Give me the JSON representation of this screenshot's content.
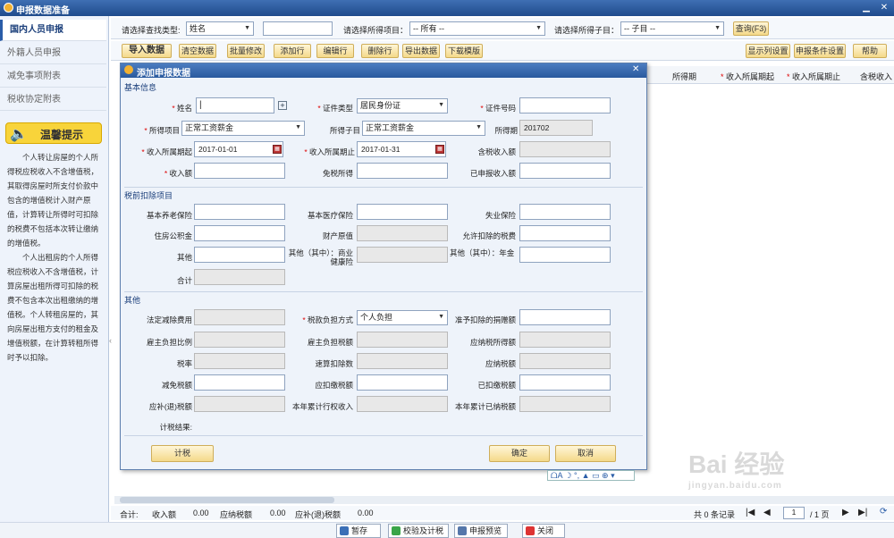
{
  "app": {
    "title": "申报数据准备"
  },
  "sidebar": {
    "items": [
      {
        "label": "国内人员申报"
      },
      {
        "label": "外籍人员申报"
      },
      {
        "label": "减免事项附表"
      },
      {
        "label": "税收协定附表"
      }
    ],
    "tip_title": "温馨提示",
    "tip_p1": "个人转让房屋的个人所得税应税收入不含增值税，其取得房屋时所支付价款中包含的增值税计入财产原值，计算转让所得时可扣除的税费不包括本次转让缴纳的增值税。",
    "tip_p2": "个人出租房的个人所得税应税收入不含增值税，计算房屋出租所得可扣除的税费不包含本次出租缴纳的增值税。个人转租房屋的，其向房屋出租方支付的租金及增值税额，在计算转租所得时予以扣除。"
  },
  "filter": {
    "lookup_label": "请选择查找类型:",
    "lookup_value": "姓名",
    "income_item_label": "请选择所得项目：",
    "income_item_value": "-- 所有 --",
    "income_sub_label": "请选择所得子目：",
    "income_sub_value": "-- 子目 --",
    "query_button": "查询(F3)"
  },
  "toolbar": {
    "import": "导入数据",
    "clear": "清空数据",
    "batch_edit": "批量修改",
    "add_row": "添加行",
    "edit_row": "编辑行",
    "delete_row": "删除行",
    "export": "导出数据",
    "template": "下载模版",
    "display_settings": "显示列设置",
    "declare_settings": "申报条件设置",
    "help": "帮助"
  },
  "grid_headers": [
    "所得期",
    "收入所属期起",
    "收入所属期止",
    "含税收入"
  ],
  "dialog": {
    "title": "添加申报数据",
    "sec_basic": "基本信息",
    "sec_pretax": "税前扣除项目",
    "sec_other": "其他",
    "name_label": "姓名",
    "name_value": "",
    "id_type_label": "证件类型",
    "id_type_value": "居民身份证",
    "id_no_label": "证件号码",
    "income_item_label": "所得项目",
    "income_item_value": "正常工资薪金",
    "income_sub_label": "所得子目",
    "income_sub_value": "正常工资薪金",
    "period_label": "所得期",
    "period_value": "201702",
    "start_label": "收入所属期起",
    "start_value": "2017-01-01",
    "end_label": "收入所属期止",
    "end_value": "2017-01-31",
    "taxincl_label": "含税收入额",
    "income_label": "收入额",
    "taxfree_label": "免税所得",
    "declared_label": "已申报收入额",
    "pension_label": "基本养老保险",
    "medical_label": "基本医疗保险",
    "unemp_label": "失业保险",
    "housing_label": "住房公积金",
    "orig_value_label": "财产原值",
    "allowed_tax_label": "允许扣除的税费",
    "other_label": "其他",
    "comm_health_label": "其他（其中）：商业健康险",
    "annuity_label": "其他（其中）：年金",
    "total_label": "合计",
    "legal_ded_label": "法定减除费用",
    "burden_label": "税款负担方式",
    "burden_value": "个人负担",
    "donation_label": "准予扣除的捐赠额",
    "employer_ratio_label": "雇主负担比例",
    "employer_amt_label": "雇主负担税额",
    "taxable_label": "应纳税所得额",
    "rate_label": "税率",
    "quick_ded_label": "速算扣除数",
    "tax_payable_label": "应纳税额",
    "relief_label": "减免税额",
    "withhold_label": "应扣缴税额",
    "withheld_label": "已扣缴税额",
    "refund_label": "应补(退)税额",
    "annual_income_label": "本年累计行权收入",
    "annual_paid_label": "本年累计已纳税额",
    "result_label": "计税结果:",
    "calc_button": "计税",
    "ok_button": "确定",
    "cancel_button": "取消"
  },
  "summary": {
    "total": "合计:",
    "income": "收入额",
    "income_val": "0.00",
    "tax_payable": "应纳税额",
    "tax_payable_val": "0.00",
    "refund": "应补(退)税额",
    "refund_val": "0.00",
    "records": "共 0 条记录",
    "page": "1",
    "pages": "/ 1 页"
  },
  "bottom": {
    "save": "暂存",
    "verify": "校验及计税",
    "preview": "申报预览",
    "close": "关闭"
  },
  "ime": "ᗝA ☽ °, ▲ ▭ ⊕ ▾",
  "watermark": {
    "brand": "Bai 经验",
    "url": "jingyan.baidu.com"
  }
}
